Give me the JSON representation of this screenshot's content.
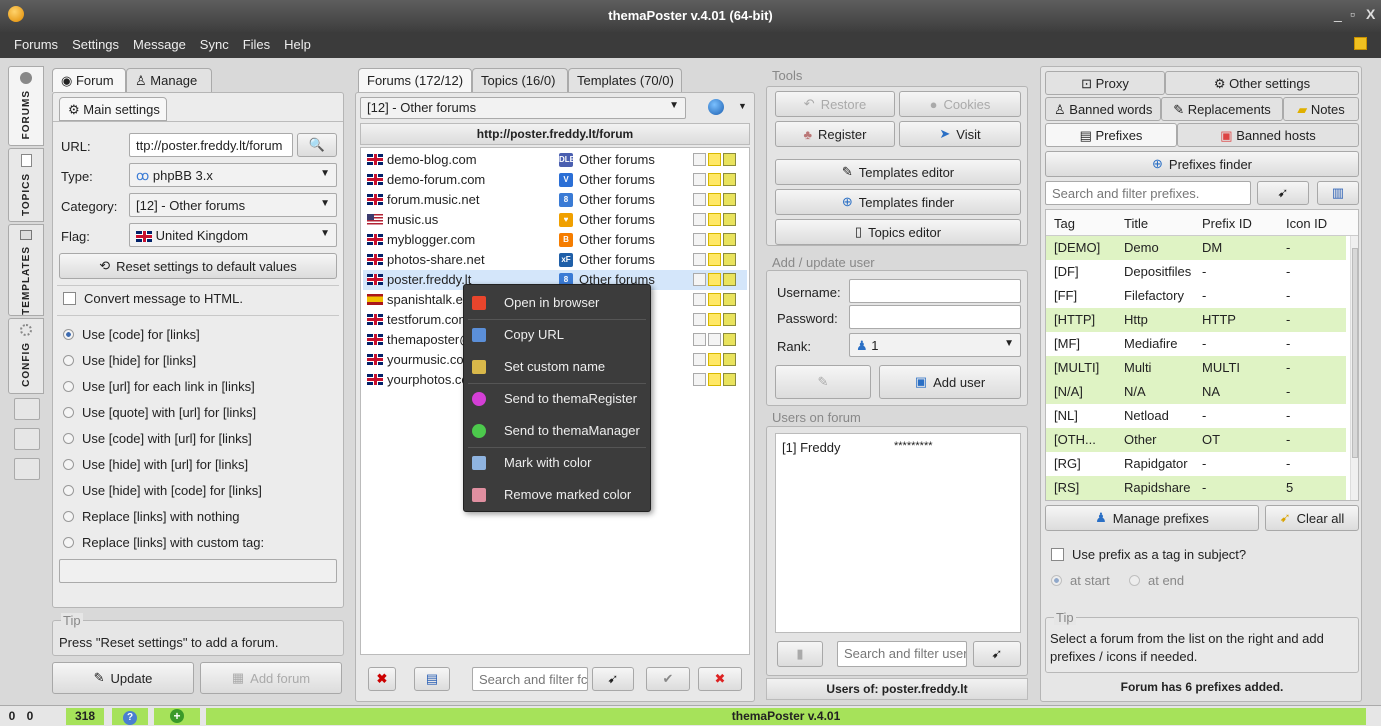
{
  "window": {
    "title": "themaPoster v.4.01  (64-bit)",
    "minimize": "_",
    "restore": "▫",
    "close": "X"
  },
  "menu": [
    "Forums",
    "Settings",
    "Message",
    "Sync",
    "Files",
    "Help"
  ],
  "vtabs": [
    "FORUMS",
    "TOPICS",
    "TEMPLATES",
    "CONFIG"
  ],
  "left": {
    "tabs": [
      "Forum",
      "Manage"
    ],
    "subtab": "Main settings",
    "url_label": "URL:",
    "url_value": "ttp://poster.freddy.lt/forum",
    "type_label": "Type:",
    "type_value": "phpBB 3.x",
    "category_label": "Category:",
    "category_value": "[12] - Other forums",
    "flag_label": "Flag:",
    "flag_value": "United Kingdom",
    "reset_button": "Reset settings to default values",
    "convert_label": "Convert message to HTML.",
    "options": [
      "Use [code] for [links]",
      "Use [hide] for [links]",
      "Use [url] for each link in [links]",
      "Use [quote] with [url] for [links]",
      "Use [code] with [url] for [links]",
      "Use [hide] with [url] for [links]",
      "Use [hide] with [code] for [links]",
      "Replace [links] with nothing",
      "Replace [links] with custom tag:"
    ],
    "selected_option": 0,
    "tip_title": "Tip",
    "tip_text": "Press \"Reset settings\" to add a forum.",
    "update_button": "Update",
    "add_forum_button": "Add forum"
  },
  "middle": {
    "tabs": [
      "Forums (172/12)",
      "Topics (16/0)",
      "Templates (70/0)"
    ],
    "forum_select": "[12] - Other forums",
    "url_header": "http://poster.freddy.lt/forum",
    "forums": [
      {
        "name": "demo-blog.com",
        "flag": "uk",
        "cat": "Other forums",
        "icon": "DLE",
        "icolor": "#4a5fb0"
      },
      {
        "name": "demo-forum.com",
        "flag": "uk",
        "cat": "Other forums",
        "icon": "V",
        "icolor": "#2b6fd6"
      },
      {
        "name": "forum.music.net",
        "flag": "uk",
        "cat": "Other forums",
        "icon": "8",
        "icolor": "#3a7bd5"
      },
      {
        "name": "music.us",
        "flag": "us",
        "cat": "Other forums",
        "icon": "♥",
        "icolor": "#f0a000"
      },
      {
        "name": "myblogger.com",
        "flag": "uk",
        "cat": "Other forums",
        "icon": "B",
        "icolor": "#f57d00"
      },
      {
        "name": "photos-share.net",
        "flag": "uk",
        "cat": "Other forums",
        "icon": "xF",
        "icolor": "#1f5fa8"
      },
      {
        "name": "poster.freddy.lt",
        "flag": "uk",
        "cat": "Other forums",
        "icon": "8",
        "icolor": "#3a7bd5"
      },
      {
        "name": "spanishtalk.es",
        "flag": "es",
        "cat": "",
        "icon": "",
        "icolor": ""
      },
      {
        "name": "testforum.com",
        "flag": "uk",
        "cat": "",
        "icon": "",
        "icolor": ""
      },
      {
        "name": "themaposter@",
        "flag": "uk",
        "cat": "",
        "icon": "",
        "icolor": ""
      },
      {
        "name": "yourmusic.cor",
        "flag": "uk",
        "cat": "",
        "icon": "",
        "icolor": ""
      },
      {
        "name": "yourphotos.co",
        "flag": "uk",
        "cat": "",
        "icon": "",
        "icolor": ""
      }
    ],
    "selected_forum": 6,
    "search_placeholder": "Search and filter fc"
  },
  "context_menu": [
    {
      "label": "Open in browser",
      "color": "#e8452c"
    },
    {
      "label": "Copy URL",
      "color": "#5b8fd9"
    },
    {
      "label": "Set custom name",
      "color": "#d9b84a"
    },
    {
      "label": "Send to themaRegister",
      "color": "#d43fd6"
    },
    {
      "label": "Send to themaManager",
      "color": "#4cc94c"
    },
    {
      "label": "Mark with color",
      "color": "#8fb4e0"
    },
    {
      "label": "Remove marked color",
      "color": "#e08fa0"
    }
  ],
  "tools": {
    "title": "Tools",
    "restore": "Restore",
    "cookies": "Cookies",
    "register": "Register",
    "visit": "Visit",
    "templates_editor": "Templates editor",
    "templates_finder": "Templates finder",
    "topics_editor": "Topics editor",
    "add_user_title": "Add / update user",
    "username_label": "Username:",
    "password_label": "Password:",
    "rank_label": "Rank:",
    "rank_value": "1",
    "add_user": "Add user",
    "users_title": "Users on forum",
    "users": [
      {
        "name": "[1] Freddy",
        "pass": "*********"
      }
    ],
    "user_search_placeholder": "Search and filter user",
    "users_of": "Users of: poster.freddy.lt"
  },
  "right": {
    "tabs_row1": [
      "Proxy",
      "Other settings"
    ],
    "tabs_row2": [
      "Banned words",
      "Replacements",
      "Notes"
    ],
    "tabs_row3": [
      "Prefixes",
      "Banned hosts"
    ],
    "prefixes_finder": "Prefixes finder",
    "search_placeholder": "Search and filter prefixes.",
    "columns": [
      "Tag",
      "Title",
      "Prefix ID",
      "Icon ID"
    ],
    "rows": [
      {
        "tag": "[DEMO]",
        "title": "Demo",
        "pid": "DM",
        "iid": "-",
        "hl": true
      },
      {
        "tag": "[DF]",
        "title": "Depositfiles",
        "pid": "-",
        "iid": "-",
        "hl": false
      },
      {
        "tag": "[FF]",
        "title": "Filefactory",
        "pid": "-",
        "iid": "-",
        "hl": false
      },
      {
        "tag": "[HTTP]",
        "title": "Http",
        "pid": "HTTP",
        "iid": "-",
        "hl": true
      },
      {
        "tag": "[MF]",
        "title": "Mediafire",
        "pid": "-",
        "iid": "-",
        "hl": false
      },
      {
        "tag": "[MULTI]",
        "title": "Multi",
        "pid": "MULTI",
        "iid": "-",
        "hl": true
      },
      {
        "tag": "[N/A]",
        "title": "N/A",
        "pid": "NA",
        "iid": "-",
        "hl": true
      },
      {
        "tag": "[NL]",
        "title": "Netload",
        "pid": "-",
        "iid": "-",
        "hl": false
      },
      {
        "tag": "[OTH...",
        "title": "Other",
        "pid": "OT",
        "iid": "-",
        "hl": true
      },
      {
        "tag": "[RG]",
        "title": "Rapidgator",
        "pid": "-",
        "iid": "-",
        "hl": false
      },
      {
        "tag": "[RS]",
        "title": "Rapidshare",
        "pid": "-",
        "iid": "5",
        "hl": true
      }
    ],
    "manage_prefixes": "Manage prefixes",
    "clear_all": "Clear all",
    "use_prefix": "Use prefix as a tag in subject?",
    "at_start": "at start",
    "at_end": "at end",
    "tip_title": "Tip",
    "tip_text": "Select a forum from the list on the right and add prefixes / icons if needed.",
    "footer": "Forum has 6 prefixes added."
  },
  "status": {
    "c1": "0",
    "c2": "0",
    "c3": "318",
    "center": "themaPoster v.4.01"
  }
}
